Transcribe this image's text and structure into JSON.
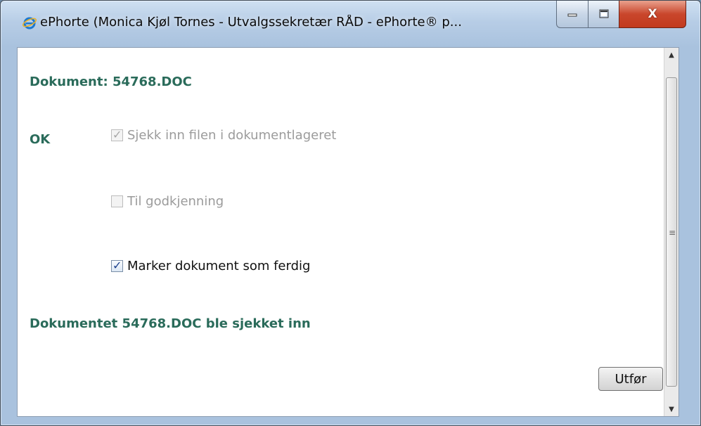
{
  "window": {
    "title": "ePhorte (Monica Kjøl Tornes - Utvalgssekretær RÅD - ePhorte® p...",
    "controls": {
      "minimize_icon": "minimize-icon",
      "maximize_icon": "maximize-icon",
      "close_icon": "close-icon",
      "close_label": "X"
    }
  },
  "dialog": {
    "document_label": "Dokument: 54768.DOC",
    "status_label": "OK",
    "options": [
      {
        "label": "Sjekk inn filen i dokumentlageret",
        "checked": true,
        "disabled": true
      },
      {
        "label": "Til godkjenning",
        "checked": false,
        "disabled": true
      },
      {
        "label": "Marker dokument som ferdig",
        "checked": true,
        "disabled": false
      }
    ],
    "result_message": "Dokumentet 54768.DOC ble sjekket inn",
    "submit_label": "Utfør"
  },
  "colors": {
    "label_green": "#2a6b5a",
    "disabled_text": "#9b9b9b",
    "close_red": "#c9462c"
  }
}
